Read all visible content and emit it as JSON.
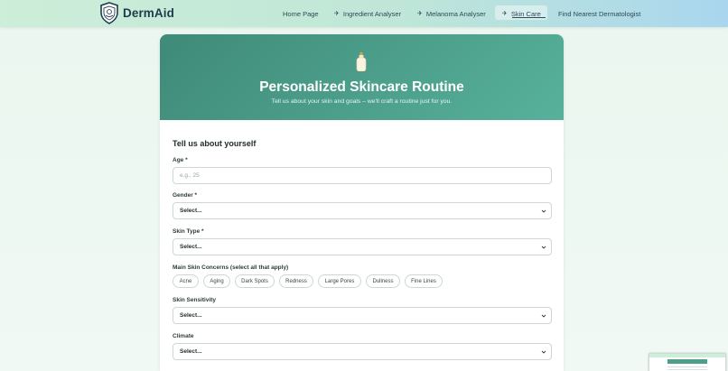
{
  "nav": {
    "brand": "DermAid",
    "links": [
      {
        "label": "Home Page",
        "icon": ""
      },
      {
        "label": "Ingredient Analyser",
        "icon": "sparkle-icon"
      },
      {
        "label": "Melanoma Analyser",
        "icon": "sparkle-icon"
      },
      {
        "label": "Skin Care",
        "icon": "sparkle-icon",
        "active": true
      },
      {
        "label": "Find Nearest Dermatologist",
        "icon": ""
      }
    ],
    "icon_glyph": "✈"
  },
  "hero": {
    "title": "Personalized Skincare Routine",
    "subtitle": "Tell us about your skin and goals – we'll craft a routine just for you."
  },
  "form": {
    "section_title": "Tell us about yourself",
    "age": {
      "label": "Age *",
      "placeholder": "e.g., 25"
    },
    "gender": {
      "label": "Gender *",
      "value": "Select..."
    },
    "skin_type": {
      "label": "Skin Type *",
      "value": "Select..."
    },
    "concerns": {
      "label": "Main Skin Concerns (select all that apply)",
      "options": [
        "Acne",
        "Aging",
        "Dark Spots",
        "Redness",
        "Large Pores",
        "Dullness",
        "Fine Lines"
      ]
    },
    "sensitivity": {
      "label": "Skin Sensitivity",
      "value": "Select..."
    },
    "climate": {
      "label": "Climate",
      "value": "Select..."
    }
  },
  "colors": {
    "hero_start": "#3f8a78",
    "hero_end": "#57b19b",
    "brand_text": "#1f3a4d"
  }
}
